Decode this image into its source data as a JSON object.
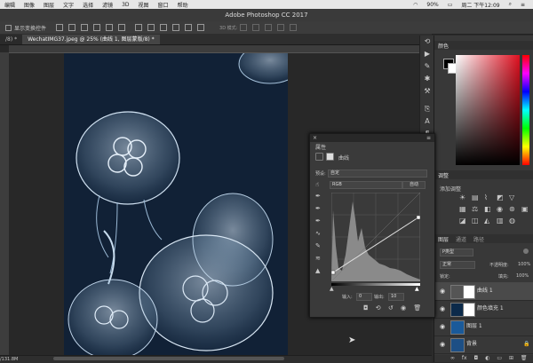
{
  "menubar": {
    "items": [
      "编辑",
      "图像",
      "图层",
      "文字",
      "选择",
      "滤镜",
      "3D",
      "视图",
      "窗口",
      "帮助"
    ],
    "battery": "90%",
    "clock": "周二 下午12:09"
  },
  "window": {
    "title": "Adobe Photoshop CC 2017"
  },
  "options": {
    "checkbox_label": "显示变换控件",
    "mode_3d": "3D 模式:"
  },
  "tabs": [
    "/8) *",
    "WechatIMG37.jpeg @ 25% (曲线 1, 图层蒙版/8) *"
  ],
  "status": {
    "doc_size": "/131.8M"
  },
  "color_panel": {
    "title": "颜色",
    "hue": "#e01020"
  },
  "adjust_panel": {
    "title": "调整",
    "subtitle": "添加调整"
  },
  "layers_panel": {
    "tabs": [
      "图层",
      "通道",
      "路径"
    ],
    "filter_label": "P类型",
    "blend_mode": "正常",
    "opacity_label": "不透明度:",
    "opacity": "100%",
    "lock_label": "锁定:",
    "fill_label": "填充:",
    "fill": "100%",
    "layers": [
      {
        "name": "曲线 1"
      },
      {
        "name": "颜色填充 1"
      },
      {
        "name": "图层 1"
      },
      {
        "name": "背景"
      }
    ]
  },
  "properties": {
    "title": "属性",
    "adj_name": "曲线",
    "preset_label": "预设:",
    "preset_value": "自定",
    "channel": "RGB",
    "auto_button": "自动",
    "input_label": "输入:",
    "input_value": "0",
    "output_label": "输出:",
    "output_value": "10"
  }
}
